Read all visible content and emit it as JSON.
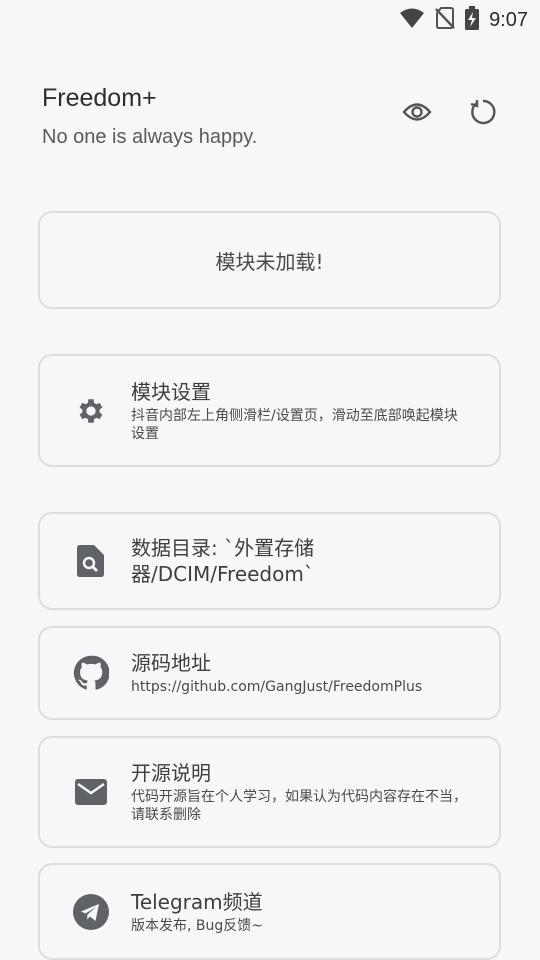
{
  "status_bar": {
    "time": "9:07",
    "icons": [
      "wifi-icon",
      "no-sim-icon",
      "battery-charging-icon"
    ]
  },
  "header": {
    "title": "Freedom+",
    "subtitle": "No one is always happy.",
    "actions": [
      "eye-icon",
      "refresh-icon"
    ]
  },
  "status_card": {
    "text": "模块未加载!"
  },
  "items": [
    {
      "icon": "gear-icon",
      "title": "模块设置",
      "desc": "抖音内部左上角侧滑栏/设置页，滑动至底部唤起模块设置"
    },
    {
      "icon": "file-search-icon",
      "title": "数据目录: `外置存储器/DCIM/Freedom`",
      "desc": ""
    },
    {
      "icon": "github-icon",
      "title": "源码地址",
      "desc": "https://github.com/GangJust/FreedomPlus"
    },
    {
      "icon": "mail-icon",
      "title": "开源说明",
      "desc": "代码开源旨在个人学习，如果认为代码内容存在不当，请联系删除"
    },
    {
      "icon": "telegram-icon",
      "title": "Telegram频道",
      "desc": "版本发布, Bug反馈~"
    }
  ],
  "colors": {
    "background": "#f6f7f9",
    "card_border": "#dcdde0",
    "icon": "#5f6266"
  }
}
